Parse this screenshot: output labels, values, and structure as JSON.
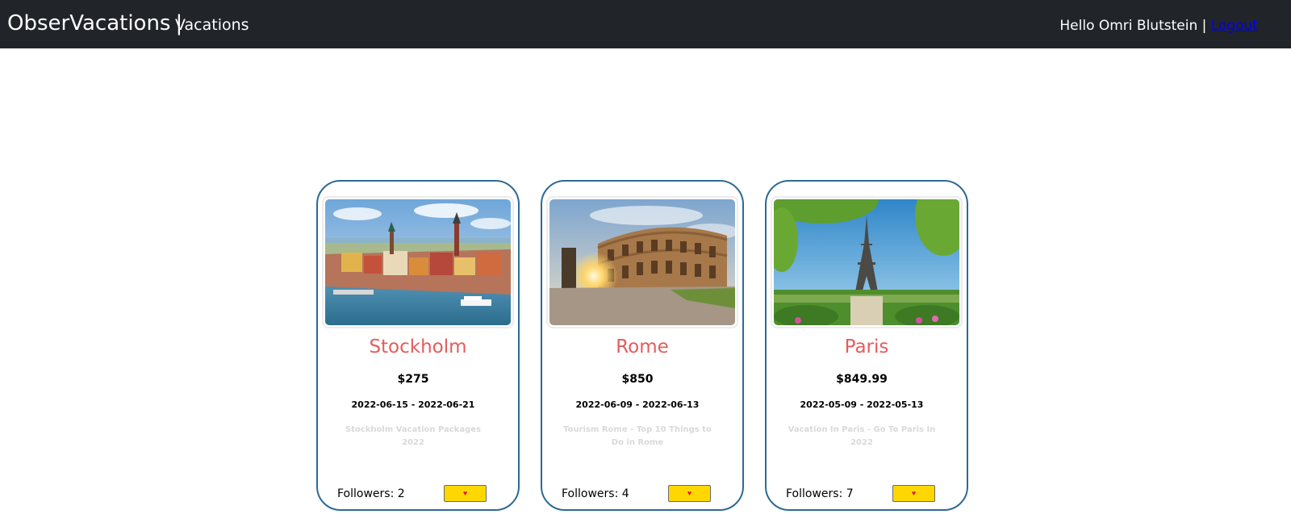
{
  "navbar": {
    "brand": "ObserVacations",
    "separator": "|",
    "section": "Vacations",
    "greeting": "Hello Omri Blutstein |",
    "logout": "Logout"
  },
  "cards": [
    {
      "destination": "Stockholm",
      "price": "$275",
      "dates": "2022-06-15 - 2022-06-21",
      "description": "Stockholm Vacation Packages 2022",
      "followers": "Followers: 2",
      "follow_icon": "heart-icon"
    },
    {
      "destination": "Rome",
      "price": "$850",
      "dates": "2022-06-09 - 2022-06-13",
      "description": "Tourism Rome - Top 10 Things to Do in Rome",
      "followers": "Followers: 4",
      "follow_icon": "heart-icon"
    },
    {
      "destination": "Paris",
      "price": "$849.99",
      "dates": "2022-05-09 - 2022-05-13",
      "description": "Vacation In Paris - Go To Paris In 2022",
      "followers": "Followers: 7",
      "follow_icon": "heart-icon"
    }
  ],
  "colors": {
    "navbar_bg": "#212529",
    "card_border": "#2d6a94",
    "destination_title": "#e35d5d",
    "follow_button": "#ffd700",
    "heart": "#e0174b"
  }
}
